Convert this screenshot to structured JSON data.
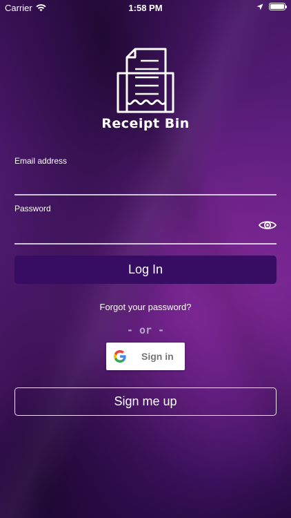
{
  "status_bar": {
    "carrier": "Carrier",
    "time": "1:58 PM",
    "battery_level": 1.0,
    "icons": [
      "wifi-icon",
      "location-arrow-icon",
      "battery-icon"
    ]
  },
  "app": {
    "title": "Receipt Bin",
    "logo_icon": "receipt-icon"
  },
  "form": {
    "email_label": "Email address",
    "email_value": "",
    "password_label": "Password",
    "password_value": "",
    "show_password_icon": "eye-icon",
    "login_label": "Log In",
    "forgot_label": "Forgot your password?",
    "or_label": "- or -",
    "google_label": "Sign in",
    "signup_label": "Sign me up"
  },
  "colors": {
    "background": "#5a1f7d",
    "login_button": "#370c63",
    "or_text": "#b9a6c7"
  }
}
